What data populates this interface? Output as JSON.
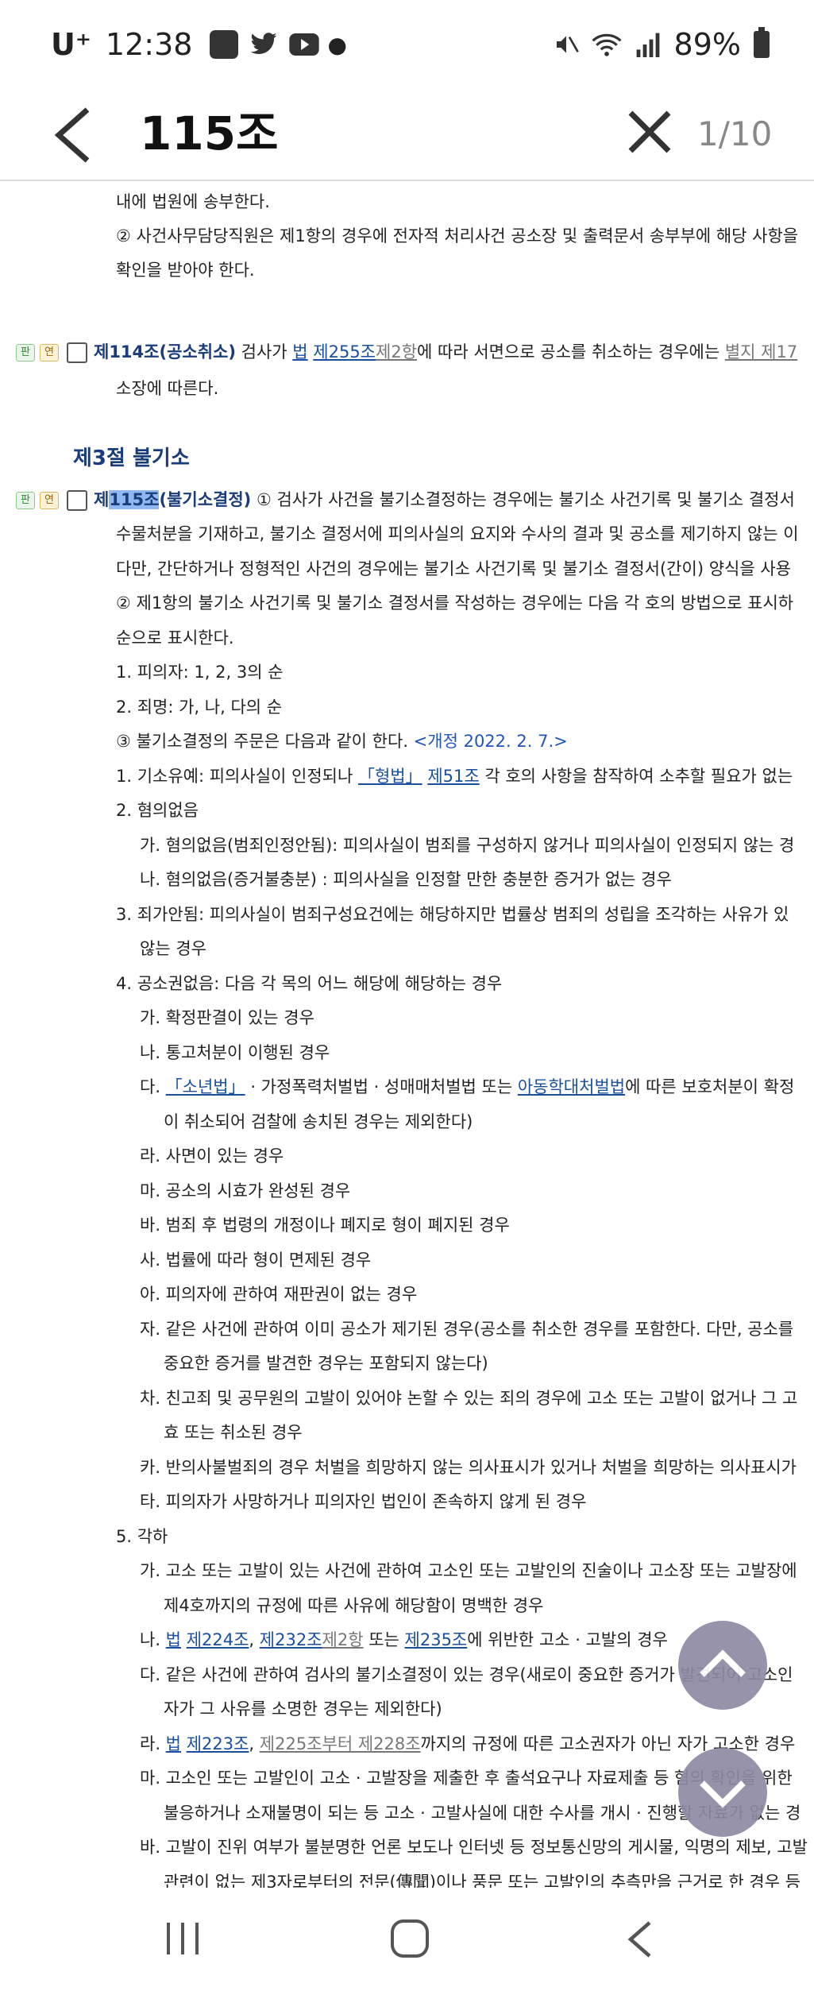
{
  "status_bar": {
    "carrier": "U⁺",
    "time": "12:38",
    "battery": "89%",
    "icons": [
      "notification-app-icon",
      "twitter-icon",
      "youtube-icon",
      "mute-icon",
      "wifi-icon",
      "signal-icon",
      "battery-icon"
    ]
  },
  "search": {
    "query": "115조",
    "result_count": "1/10"
  },
  "lines": [
    {
      "t": "내에 법원에 송부한다."
    },
    {
      "t": "② 사건사무담당직원은 제1항의 경우에 전자적 처리사건 공소장 및 출력문서 송부부에 해당 사항을"
    },
    {
      "t": "확인을 받아야 한다."
    }
  ],
  "art114": {
    "badge_p": "판",
    "badge_y": "연",
    "title": "제114조(공소취소)",
    "t1": " 검사가 ",
    "l1": "법",
    "t2": " ",
    "l2": "제255조",
    "l3": "제2항",
    "t3": "에 따라 서면으로 공소를 취소하는 경우에는 ",
    "l4": "별지 제17",
    "cont": "소장에 따른다."
  },
  "section_title": "제3절 불기소",
  "art115": {
    "badge_p": "판",
    "badge_y": "연",
    "pre": "제",
    "hl": "115조",
    "post": "(불기소결정)",
    "text": " ① 검사가 사건을 불기소결정하는 경우에는 불기소 사건기록 및 불기소 결정서"
  },
  "body": [
    "수물처분을 기재하고, 불기소 결정서에 피의사실의 요지와 수사의 결과 및 공소를 제기하지 않는 이",
    "다만, 간단하거나 정형적인 사건의 경우에는 불기소 사건기록 및 불기소 결정서(간이) 양식을 사용",
    "② 제1항의 불기소 사건기록 및 불기소 결정서를 작성하는 경우에는 다음 각 호의 방법으로 표시하",
    "순으로 표시한다.",
    "1. 피의자: 1, 2, 3의 순",
    "2. 죄명: 가, 나, 다의 순"
  ],
  "p3": {
    "t": "③ 불기소결정의 주문은 다음과 같이 한다. ",
    "rev": "<개정 2022. 2. 7.>"
  },
  "item1": {
    "a": "1. 기소유예: 피의사실이 인정되나 ",
    "l1": "「형법」",
    "b": " ",
    "l2": "제51조",
    "c": " 각 호의 사항을 참작하여 소추할 필요가 없는"
  },
  "items_a": [
    "2. 혐의없음",
    "가. 혐의없음(범죄인정안됨): 피의사실이 범죄를 구성하지 않거나 피의사실이 인정되지 않는 경",
    "나. 혐의없음(증거불충분) : 피의사실을 인정할 만한 충분한 증거가 없는 경우",
    "3. 죄가안됨: 피의사실이 범죄구성요건에는 해당하지만 법률상 범죄의 성립을 조각하는 사유가 있",
    "않는 경우",
    "4. 공소권없음: 다음 각 목의 어느 해당에 해당하는 경우",
    "가. 확정판결이 있는 경우",
    "나. 통고처분이 이행된 경우"
  ],
  "itemDa": {
    "a": "다. ",
    "l1": "「소년법」",
    "b": " · 가정폭력처벌법 · 성매매처벌법 또는 ",
    "l2": "아동학대처벌법",
    "c": "에 따른 보호처분이 확정"
  },
  "items_b": [
    "이 취소되어 검찰에 송치된 경우는 제외한다)",
    "라. 사면이 있는 경우",
    "마. 공소의 시효가 완성된 경우",
    "바. 범죄 후 법령의 개정이나 폐지로 형이 폐지된 경우",
    "사. 법률에 따라 형이 면제된 경우",
    "아. 피의자에 관하여 재판권이 없는 경우",
    "자. 같은 사건에 관하여 이미 공소가 제기된 경우(공소를 취소한 경우를 포함한다. 다만, 공소를",
    "중요한 증거를 발견한 경우는 포함되지 않는다)",
    "차. 친고죄 및 공무원의 고발이 있어야 논할 수 있는 죄의 경우에 고소 또는 고발이 없거나 그 고",
    "효 또는 취소된 경우",
    "카. 반의사불벌죄의 경우 처벌을 희망하지 않는 의사표시가 있거나 처벌을 희망하는 의사표시가",
    "타. 피의자가 사망하거나 피의자인 법인이 존속하지 않게 된 경우",
    "5. 각하",
    "가. 고소 또는 고발이 있는 사건에 관하여 고소인 또는 고발인의 진술이나 고소장 또는 고발장에",
    "제4호까지의 규정에 따른 사유에 해당함이 명백한 경우"
  ],
  "itemNa": {
    "a": "나. ",
    "l1": "법",
    "b": " ",
    "l2": "제224조",
    "c": ", ",
    "l3": "제232조",
    "l4": "제2항",
    "d": " 또는 ",
    "l5": "제235조",
    "e": "에 위반한 고소 · 고발의 경우"
  },
  "items_c": [
    "다. 같은 사건에 관하여 검사의 불기소결정이 있는 경우(새로이 중요한 증거가 발견되어 고소인",
    "자가 그 사유를 소명한 경우는 제외한다)"
  ],
  "itemRa": {
    "a": "라. ",
    "l1": "법",
    "b": " ",
    "l2": "제223조",
    "c": ", ",
    "l3": "제225조부터 제228조",
    "d": "까지의 규정에 따른 고소권자가 아닌 자가 고소한 경우"
  },
  "items_d": [
    "마. 고소인 또는 고발인이 고소 · 고발장을 제출한 후 출석요구나 자료제출 등 혐의 확인을 위한",
    "불응하거나 소재불명이 되는 등 고소 · 고발사실에 대한 수사를 개시 · 진행할 자료가 없는 경",
    "바. 고발이 진위 여부가 불분명한 언론 보도나 인터넷 등 정보통신망의 게시물, 익명의 제보, 고발",
    "관련이 없는 제3자로부터의 전문(傳聞)이나 풍문 또는 고발인의 추측만을 근거로 한 경우 등"
  ]
}
